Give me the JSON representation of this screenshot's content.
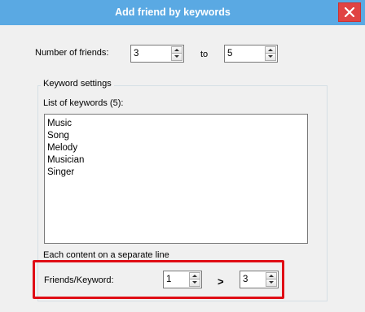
{
  "window": {
    "title": "Add friend by keywords",
    "accent_color": "#5aa9e3",
    "close_color": "#e04343"
  },
  "friends": {
    "label": "Number of friends:",
    "min_value": "3",
    "to_label": "to",
    "max_value": "5"
  },
  "keywords": {
    "group_title": "Keyword settings",
    "list_label": "List of keywords (5):",
    "items": [
      "Music",
      "Song",
      "Melody",
      "Musician",
      "Singer"
    ],
    "hint": "Each content on a separate line"
  },
  "per_keyword": {
    "label": "Friends/Keyword:",
    "min_value": "1",
    "separator": ">",
    "max_value": "3",
    "highlight_color": "#e00d15"
  }
}
